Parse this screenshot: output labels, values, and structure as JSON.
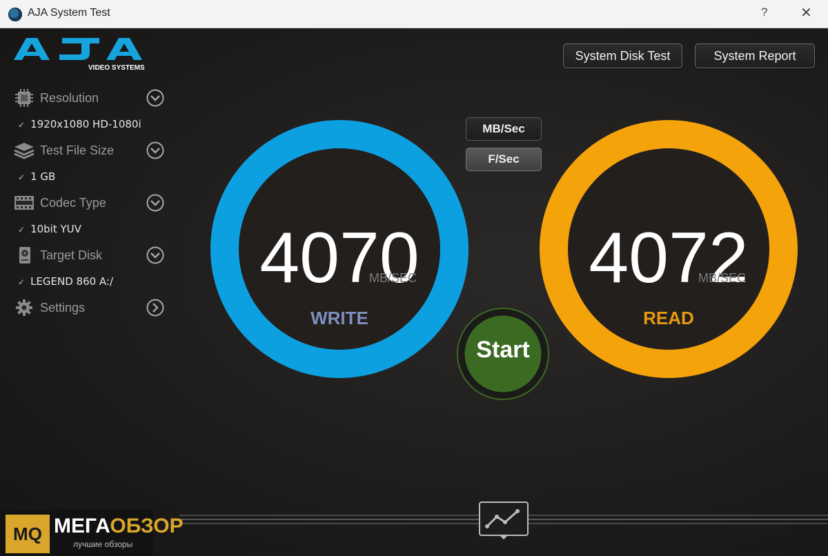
{
  "window": {
    "title": "AJA System Test",
    "help_label": "?",
    "close_label": "✕"
  },
  "logo": {
    "brand": "AJA",
    "tagline": "VIDEO SYSTEMS"
  },
  "sidebar": {
    "items": [
      {
        "label": "Resolution",
        "icon": "chip-icon",
        "value": "1920x1080 HD-1080i"
      },
      {
        "label": "Test File Size",
        "icon": "stack-icon",
        "value": "1 GB"
      },
      {
        "label": "Codec Type",
        "icon": "film-icon",
        "value": "10bit YUV"
      },
      {
        "label": "Target Disk",
        "icon": "disk-icon",
        "value": "LEGEND 860 A:/"
      },
      {
        "label": "Settings",
        "icon": "gear-icon"
      }
    ]
  },
  "toolbar": {
    "system_disk_test": "System Disk Test",
    "system_report": "System Report"
  },
  "units": {
    "mb_sec": "MB/Sec",
    "f_sec": "F/Sec",
    "selected": "F/Sec"
  },
  "write": {
    "value": "4070",
    "unit": "MB/SEC",
    "label": "WRITE",
    "color": "#0da0e0",
    "label_color": "#7e8fbf"
  },
  "read": {
    "value": "4072",
    "unit": "MB/SEC",
    "label": "READ",
    "color": "#f5a30b",
    "label_color": "#e59a12"
  },
  "start_button": {
    "label": "Start",
    "color": "#3b6a22"
  },
  "watermark": {
    "mark": "MQ",
    "title_left": "МЕГА",
    "title_right": "ОБЗОР",
    "subtitle": "лучшие обзоры"
  }
}
